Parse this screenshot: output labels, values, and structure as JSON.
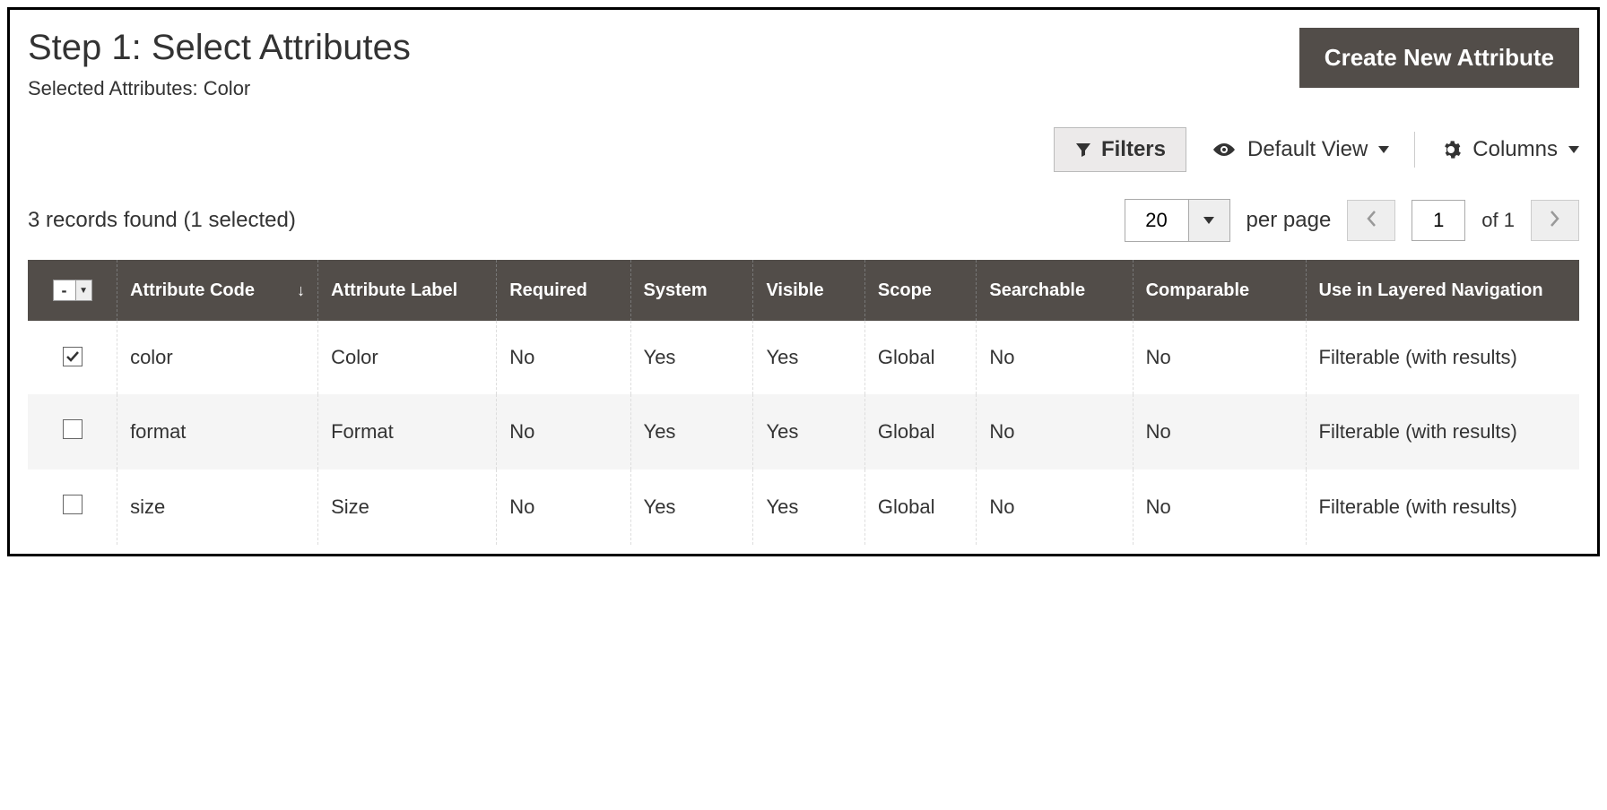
{
  "header": {
    "title": "Step 1: Select Attributes",
    "subtitle_label": "Selected Attributes:",
    "subtitle_value": "Color",
    "create_btn": "Create New Attribute"
  },
  "toolbar": {
    "filters": "Filters",
    "default_view": "Default View",
    "columns": "Columns"
  },
  "grid": {
    "records_text": "3 records found (1 selected)",
    "page_size": "20",
    "per_page_label": "per page",
    "current_page": "1",
    "of_label": "of 1",
    "columns": {
      "code": "Attribute Code",
      "label": "Attribute Label",
      "required": "Required",
      "system": "System",
      "visible": "Visible",
      "scope": "Scope",
      "searchable": "Searchable",
      "comparable": "Comparable",
      "layered": "Use in Layered Navigation"
    },
    "rows": [
      {
        "checked": true,
        "code": "color",
        "label": "Color",
        "required": "No",
        "system": "Yes",
        "visible": "Yes",
        "scope": "Global",
        "searchable": "No",
        "comparable": "No",
        "layered": "Filterable (with results)"
      },
      {
        "checked": false,
        "code": "format",
        "label": "Format",
        "required": "No",
        "system": "Yes",
        "visible": "Yes",
        "scope": "Global",
        "searchable": "No",
        "comparable": "No",
        "layered": "Filterable (with results)"
      },
      {
        "checked": false,
        "code": "size",
        "label": "Size",
        "required": "No",
        "system": "Yes",
        "visible": "Yes",
        "scope": "Global",
        "searchable": "No",
        "comparable": "No",
        "layered": "Filterable (with results)"
      }
    ]
  },
  "icons": {
    "sort_indicator": "↓"
  }
}
